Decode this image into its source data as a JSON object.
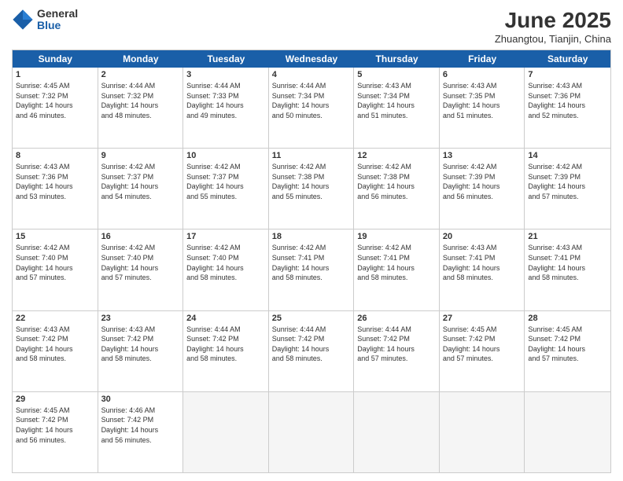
{
  "logo": {
    "general": "General",
    "blue": "Blue"
  },
  "header": {
    "month": "June 2025",
    "location": "Zhuangtou, Tianjin, China"
  },
  "weekdays": [
    "Sunday",
    "Monday",
    "Tuesday",
    "Wednesday",
    "Thursday",
    "Friday",
    "Saturday"
  ],
  "rows": [
    [
      {
        "day": "1",
        "text": "Sunrise: 4:45 AM\nSunset: 7:32 PM\nDaylight: 14 hours\nand 46 minutes."
      },
      {
        "day": "2",
        "text": "Sunrise: 4:44 AM\nSunset: 7:32 PM\nDaylight: 14 hours\nand 48 minutes."
      },
      {
        "day": "3",
        "text": "Sunrise: 4:44 AM\nSunset: 7:33 PM\nDaylight: 14 hours\nand 49 minutes."
      },
      {
        "day": "4",
        "text": "Sunrise: 4:44 AM\nSunset: 7:34 PM\nDaylight: 14 hours\nand 50 minutes."
      },
      {
        "day": "5",
        "text": "Sunrise: 4:43 AM\nSunset: 7:34 PM\nDaylight: 14 hours\nand 51 minutes."
      },
      {
        "day": "6",
        "text": "Sunrise: 4:43 AM\nSunset: 7:35 PM\nDaylight: 14 hours\nand 51 minutes."
      },
      {
        "day": "7",
        "text": "Sunrise: 4:43 AM\nSunset: 7:36 PM\nDaylight: 14 hours\nand 52 minutes."
      }
    ],
    [
      {
        "day": "8",
        "text": "Sunrise: 4:43 AM\nSunset: 7:36 PM\nDaylight: 14 hours\nand 53 minutes."
      },
      {
        "day": "9",
        "text": "Sunrise: 4:42 AM\nSunset: 7:37 PM\nDaylight: 14 hours\nand 54 minutes."
      },
      {
        "day": "10",
        "text": "Sunrise: 4:42 AM\nSunset: 7:37 PM\nDaylight: 14 hours\nand 55 minutes."
      },
      {
        "day": "11",
        "text": "Sunrise: 4:42 AM\nSunset: 7:38 PM\nDaylight: 14 hours\nand 55 minutes."
      },
      {
        "day": "12",
        "text": "Sunrise: 4:42 AM\nSunset: 7:38 PM\nDaylight: 14 hours\nand 56 minutes."
      },
      {
        "day": "13",
        "text": "Sunrise: 4:42 AM\nSunset: 7:39 PM\nDaylight: 14 hours\nand 56 minutes."
      },
      {
        "day": "14",
        "text": "Sunrise: 4:42 AM\nSunset: 7:39 PM\nDaylight: 14 hours\nand 57 minutes."
      }
    ],
    [
      {
        "day": "15",
        "text": "Sunrise: 4:42 AM\nSunset: 7:40 PM\nDaylight: 14 hours\nand 57 minutes."
      },
      {
        "day": "16",
        "text": "Sunrise: 4:42 AM\nSunset: 7:40 PM\nDaylight: 14 hours\nand 57 minutes."
      },
      {
        "day": "17",
        "text": "Sunrise: 4:42 AM\nSunset: 7:40 PM\nDaylight: 14 hours\nand 58 minutes."
      },
      {
        "day": "18",
        "text": "Sunrise: 4:42 AM\nSunset: 7:41 PM\nDaylight: 14 hours\nand 58 minutes."
      },
      {
        "day": "19",
        "text": "Sunrise: 4:42 AM\nSunset: 7:41 PM\nDaylight: 14 hours\nand 58 minutes."
      },
      {
        "day": "20",
        "text": "Sunrise: 4:43 AM\nSunset: 7:41 PM\nDaylight: 14 hours\nand 58 minutes."
      },
      {
        "day": "21",
        "text": "Sunrise: 4:43 AM\nSunset: 7:41 PM\nDaylight: 14 hours\nand 58 minutes."
      }
    ],
    [
      {
        "day": "22",
        "text": "Sunrise: 4:43 AM\nSunset: 7:42 PM\nDaylight: 14 hours\nand 58 minutes."
      },
      {
        "day": "23",
        "text": "Sunrise: 4:43 AM\nSunset: 7:42 PM\nDaylight: 14 hours\nand 58 minutes."
      },
      {
        "day": "24",
        "text": "Sunrise: 4:44 AM\nSunset: 7:42 PM\nDaylight: 14 hours\nand 58 minutes."
      },
      {
        "day": "25",
        "text": "Sunrise: 4:44 AM\nSunset: 7:42 PM\nDaylight: 14 hours\nand 58 minutes."
      },
      {
        "day": "26",
        "text": "Sunrise: 4:44 AM\nSunset: 7:42 PM\nDaylight: 14 hours\nand 57 minutes."
      },
      {
        "day": "27",
        "text": "Sunrise: 4:45 AM\nSunset: 7:42 PM\nDaylight: 14 hours\nand 57 minutes."
      },
      {
        "day": "28",
        "text": "Sunrise: 4:45 AM\nSunset: 7:42 PM\nDaylight: 14 hours\nand 57 minutes."
      }
    ],
    [
      {
        "day": "29",
        "text": "Sunrise: 4:45 AM\nSunset: 7:42 PM\nDaylight: 14 hours\nand 56 minutes."
      },
      {
        "day": "30",
        "text": "Sunrise: 4:46 AM\nSunset: 7:42 PM\nDaylight: 14 hours\nand 56 minutes."
      },
      {
        "day": "",
        "text": ""
      },
      {
        "day": "",
        "text": ""
      },
      {
        "day": "",
        "text": ""
      },
      {
        "day": "",
        "text": ""
      },
      {
        "day": "",
        "text": ""
      }
    ]
  ]
}
